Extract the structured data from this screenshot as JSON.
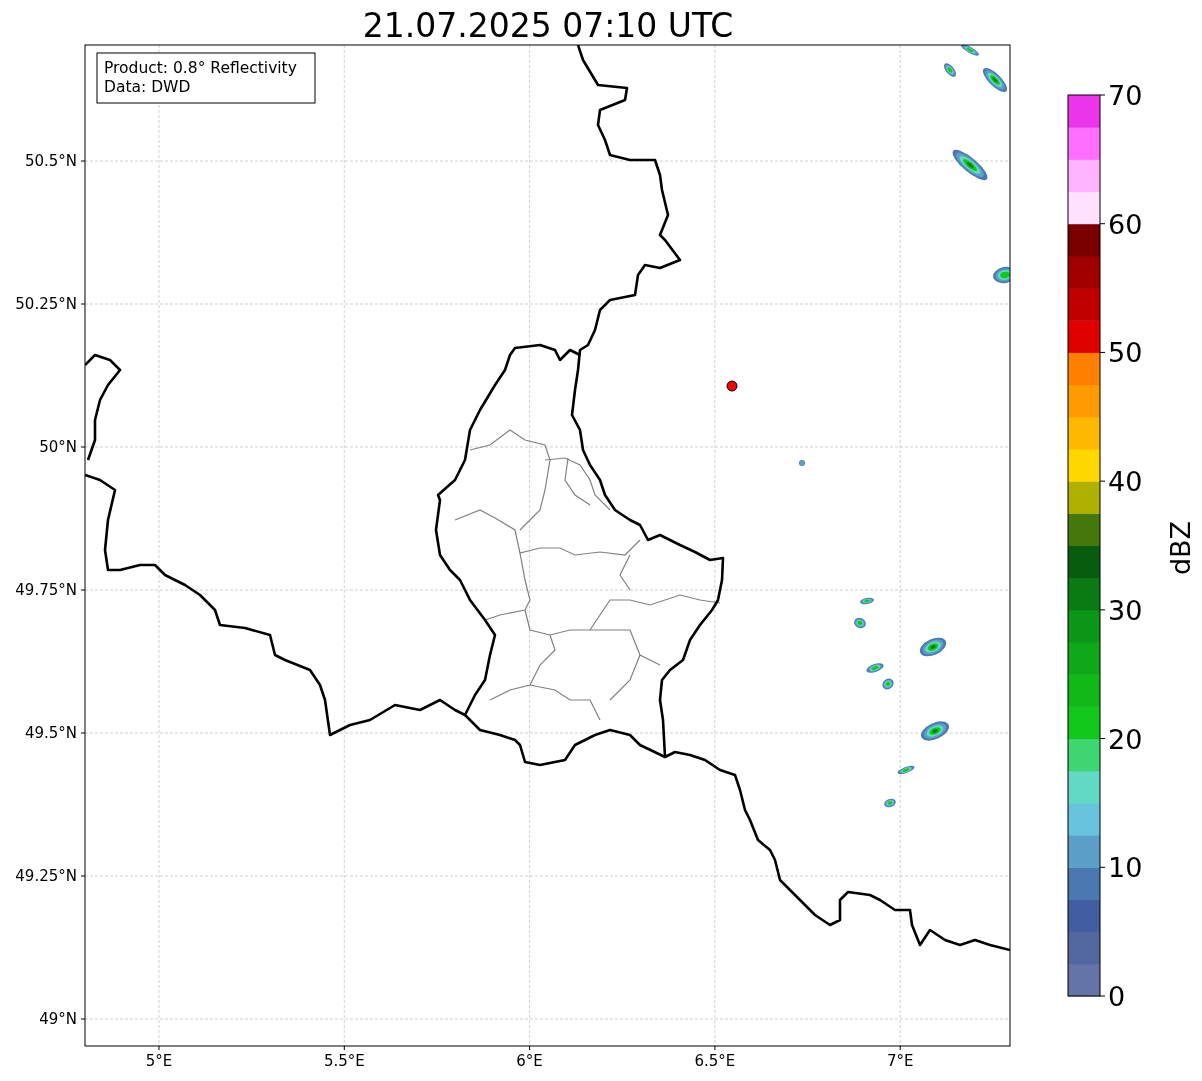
{
  "title": "21.07.2025 07:10 UTC",
  "info_box": {
    "lines": [
      "Product: 0.8° Reflectivity",
      "Data: DWD"
    ]
  },
  "map": {
    "lat_ticks": [
      {
        "label": "50.5°N"
      },
      {
        "label": "50.25°N"
      },
      {
        "label": "50°N"
      },
      {
        "label": "49.75°N"
      },
      {
        "label": "49.5°N"
      },
      {
        "label": "49.25°N"
      },
      {
        "label": "49°N"
      }
    ],
    "lon_ticks": [
      {
        "label": "5°E"
      },
      {
        "label": "5.5°E"
      },
      {
        "label": "6°E"
      },
      {
        "label": "6.5°E"
      },
      {
        "label": "7°E"
      }
    ]
  },
  "colorbar": {
    "label": "dBZ",
    "ticks": [
      "70",
      "60",
      "50",
      "40",
      "30",
      "20",
      "10",
      "0"
    ],
    "bands": [
      {
        "color": "#6474a8"
      },
      {
        "color": "#5468a0"
      },
      {
        "color": "#425da0"
      },
      {
        "color": "#4a78b0"
      },
      {
        "color": "#5b9ec6"
      },
      {
        "color": "#68c3dc"
      },
      {
        "color": "#62d9c4"
      },
      {
        "color": "#3dd671"
      },
      {
        "color": "#12c81a"
      },
      {
        "color": "#10b818"
      },
      {
        "color": "#0ea818"
      },
      {
        "color": "#0c9618"
      },
      {
        "color": "#0a7a12"
      },
      {
        "color": "#075c0e"
      },
      {
        "color": "#45780a"
      },
      {
        "color": "#b0b000"
      },
      {
        "color": "#ffd700"
      },
      {
        "color": "#ffb800"
      },
      {
        "color": "#ff9a00"
      },
      {
        "color": "#ff7f00"
      },
      {
        "color": "#e10000"
      },
      {
        "color": "#c00000"
      },
      {
        "color": "#a00000"
      },
      {
        "color": "#7a0000"
      },
      {
        "color": "#ffe0ff"
      },
      {
        "color": "#ffb3ff"
      },
      {
        "color": "#ff6eff"
      },
      {
        "color": "#ea35ea"
      }
    ]
  }
}
